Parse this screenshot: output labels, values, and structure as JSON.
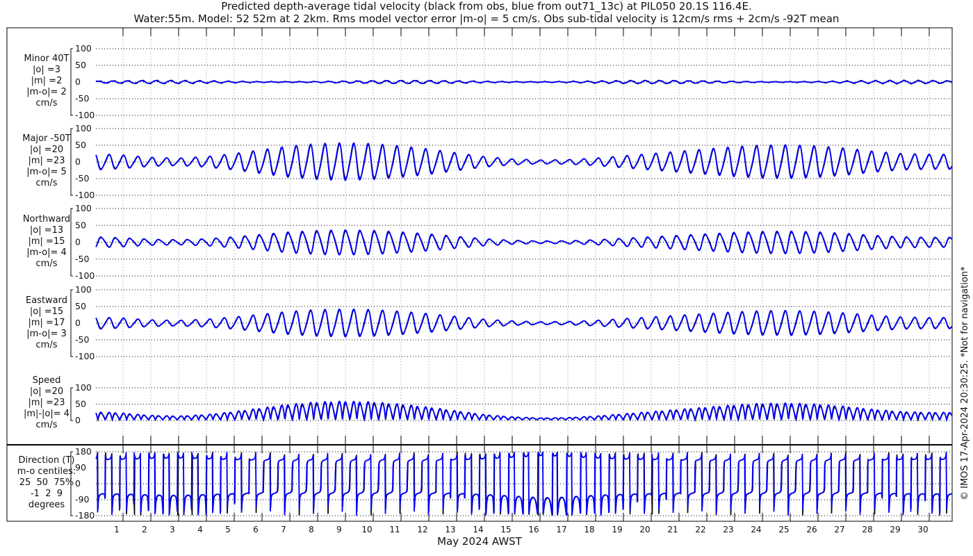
{
  "title": {
    "line1": "Predicted depth-average tidal velocity (black from obs, blue from out71_13c) at PIL050 20.1S 116.4E.",
    "line2": "Water:55m. Model: 52 52m at 2 2km. Rms model vector error |m-o| = 5 cm/s. Obs sub-tidal velocity is 12cm/s rms + 2cm/s -92T mean"
  },
  "copyright": "© IMOS 17-Apr-2024 20:30:25. *Not for navigation*",
  "colors": {
    "obs": "#000000",
    "model": "#0000ff",
    "grid": "#b8c4e8"
  },
  "chart_data": {
    "type": "line",
    "xlabel": "May 2024 AWST",
    "x_ticks": [
      "1",
      "2",
      "3",
      "4",
      "5",
      "6",
      "7",
      "8",
      "9",
      "10",
      "11",
      "12",
      "13",
      "14",
      "15",
      "16",
      "17",
      "18",
      "19",
      "20",
      "21",
      "22",
      "23",
      "24",
      "25",
      "26",
      "27",
      "28",
      "29",
      "30"
    ],
    "x_range_days": [
      0,
      30.8
    ],
    "series_names": [
      "obs",
      "model"
    ],
    "envelope_days": [
      0,
      1,
      2,
      3,
      4,
      5,
      6,
      7,
      8,
      9,
      10,
      11,
      12,
      13,
      14,
      15,
      16,
      17,
      18,
      19,
      20,
      21,
      22,
      23,
      24,
      25,
      26,
      27,
      28,
      29,
      30,
      31
    ],
    "major_envelope": [
      22,
      18,
      12,
      10,
      14,
      22,
      32,
      42,
      48,
      50,
      48,
      42,
      34,
      24,
      14,
      8,
      5,
      6,
      10,
      16,
      22,
      28,
      34,
      40,
      44,
      45,
      42,
      36,
      28,
      22,
      20,
      20
    ],
    "panels": [
      {
        "id": "minor",
        "label": [
          "Minor 40T",
          "|o| =3",
          "|m| =2",
          "|m-o|= 2",
          "cm/s"
        ],
        "ylim": [
          -100,
          100
        ],
        "yticks": [
          "100",
          "50",
          "0",
          "-50",
          "-100"
        ],
        "scale": 0.08
      },
      {
        "id": "major",
        "label": [
          "Major -50T",
          "|o| =20",
          "|m| =23",
          "|m-o|= 5",
          "cm/s"
        ],
        "ylim": [
          -100,
          100
        ],
        "yticks": [
          "100",
          "50",
          "0",
          "-50",
          "-100"
        ],
        "scale": 1.0
      },
      {
        "id": "north",
        "label": [
          "Northward",
          "|o| =13",
          "|m| =15",
          "|m-o|= 4",
          "cm/s"
        ],
        "ylim": [
          -100,
          100
        ],
        "yticks": [
          "100",
          "50",
          "0",
          "-50",
          "-100"
        ],
        "scale": 0.66
      },
      {
        "id": "east",
        "label": [
          "Eastward",
          "|o| =15",
          "|m| =17",
          "|m-o|= 3",
          "cm/s"
        ],
        "ylim": [
          -100,
          100
        ],
        "yticks": [
          "100",
          "50",
          "0",
          "-50",
          "-100"
        ],
        "scale": 0.74
      },
      {
        "id": "speed",
        "label": [
          "Speed",
          "|o| =20",
          "|m| =23",
          "|m|-|o|= 4",
          "cm/s"
        ],
        "ylim": [
          0,
          100
        ],
        "yticks": [
          "100",
          "50",
          "0"
        ],
        "scale": 1.0
      },
      {
        "id": "direction",
        "label": [
          "Direction (T)",
          "m-o centiles:",
          "25  50  75%",
          "-1  2  9",
          "degrees"
        ],
        "ylim": [
          -180,
          180
        ],
        "yticks": [
          "180",
          "90",
          "0",
          "-90",
          "-180"
        ],
        "scale": 1.0
      }
    ],
    "tidal_period_hours": 12.42
  }
}
